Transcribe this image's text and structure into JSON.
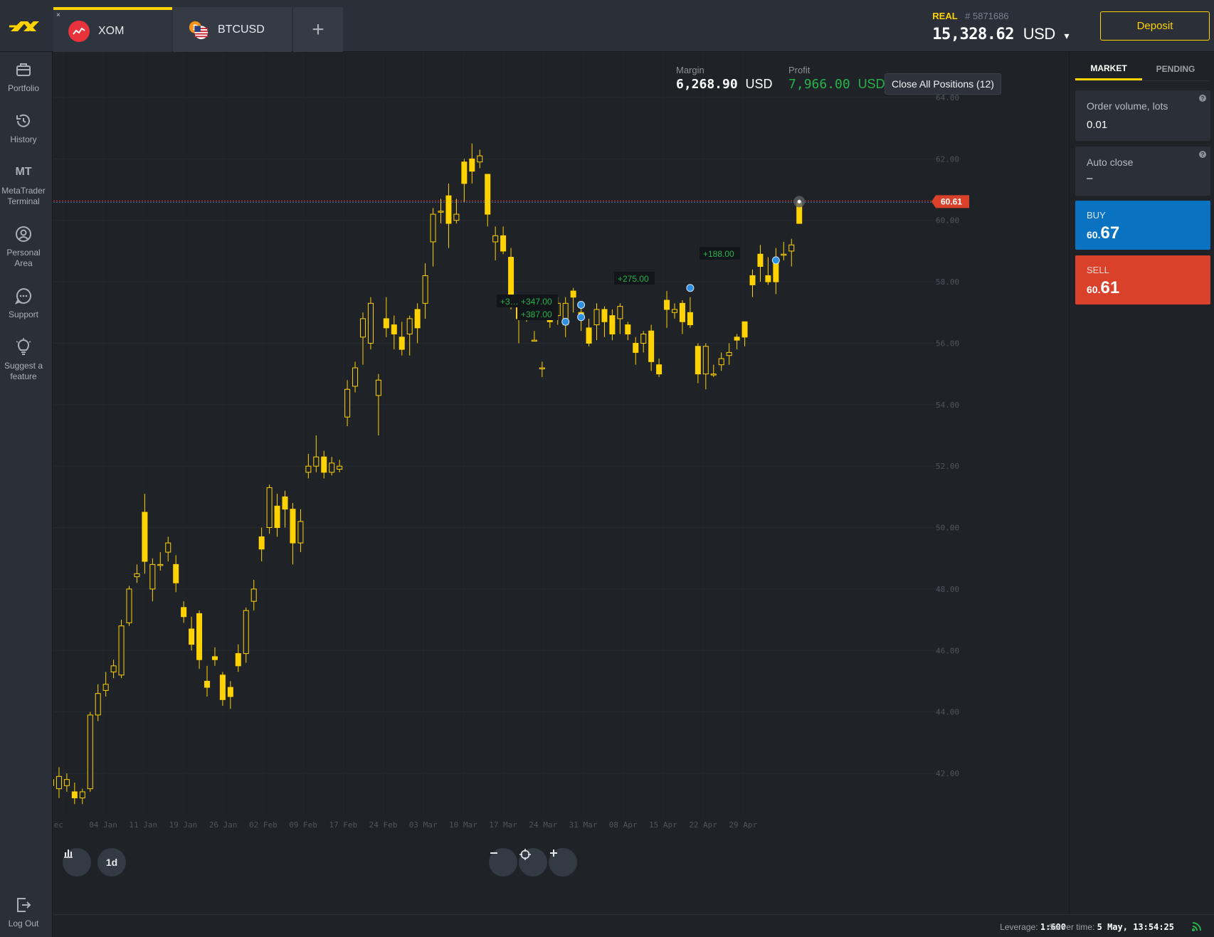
{
  "tabs": [
    {
      "label": "XOM",
      "active": true,
      "close": "×"
    },
    {
      "label": "BTCUSD",
      "active": false
    }
  ],
  "add_tab_label": "+",
  "account": {
    "type": "REAL",
    "number": "# 5871686",
    "balance": "15,328.62",
    "currency": "USD",
    "dropdown": "▾"
  },
  "deposit_label": "Deposit",
  "sidebar": {
    "items": [
      {
        "label": "Portfolio",
        "icon": "briefcase-icon"
      },
      {
        "label": "History",
        "icon": "history-icon"
      },
      {
        "label": "MetaTrader Terminal",
        "icon": "mt-icon",
        "icon_text": "MT"
      },
      {
        "label": "Personal Area",
        "icon": "user-icon"
      },
      {
        "label": "Support",
        "icon": "chat-icon"
      },
      {
        "label": "Suggest a feature",
        "icon": "lightbulb-icon"
      }
    ],
    "logout": "Log Out"
  },
  "metrics": {
    "margin_label": "Margin",
    "margin_value": "6,268.90",
    "margin_currency": "USD",
    "profit_label": "Profit",
    "profit_value": "7,966.00",
    "profit_currency": "USD"
  },
  "close_all_label": "Close All Positions (12)",
  "timeframe": "1d",
  "panel": {
    "tabs": [
      "MARKET",
      "PENDING"
    ],
    "order_volume_label": "Order volume, lots",
    "order_volume_value": "0.01",
    "auto_close_label": "Auto close",
    "auto_close_value": "–",
    "help": "?",
    "buy_label": "BUY",
    "buy_price_small": "60.",
    "buy_price_big": "67",
    "sell_label": "SELL",
    "sell_price_small": "60.",
    "sell_price_big": "61"
  },
  "status": {
    "leverage_label": "Leverage:",
    "leverage_value": "1:600",
    "server_time_label": "Server time:",
    "server_time_value": "5 May, 13:54:25"
  },
  "colors": {
    "accent": "#ffd200",
    "buy": "#0a73c1",
    "sell": "#d9412b",
    "profit": "#27b24a",
    "price_line": "#e0332c"
  },
  "chart_data": {
    "type": "candlestick",
    "symbol": "XOM",
    "timeframe": "1d",
    "y_ticks": [
      "42.00",
      "44.00",
      "46.00",
      "48.00",
      "50.00",
      "52.00",
      "54.00",
      "56.00",
      "58.00",
      "60.00",
      "62.00",
      "64.00"
    ],
    "x_ticks": [
      "Dec",
      "04 Jan",
      "11 Jan",
      "19 Jan",
      "26 Jan",
      "02 Feb",
      "09 Feb",
      "17 Feb",
      "24 Feb",
      "03 Mar",
      "10 Mar",
      "17 Mar",
      "24 Mar",
      "31 Mar",
      "08 Apr",
      "15 Apr",
      "22 Apr",
      "29 Apr"
    ],
    "ylim": [
      40.4,
      65.0
    ],
    "current_price": "60.61",
    "current_price_value": 60.61,
    "candles": [
      [
        41.6,
        41.8,
        41.3,
        41.9
      ],
      [
        41.5,
        41.9,
        41.2,
        42.2
      ],
      [
        41.6,
        41.8,
        41.4,
        42.0
      ],
      [
        41.4,
        41.2,
        41.0,
        41.7
      ],
      [
        41.2,
        41.4,
        41.0,
        41.5
      ],
      [
        41.5,
        43.9,
        41.4,
        44.0
      ],
      [
        43.9,
        44.6,
        43.7,
        44.9
      ],
      [
        44.7,
        44.9,
        44.5,
        45.3
      ],
      [
        45.3,
        45.5,
        45.1,
        45.7
      ],
      [
        45.2,
        46.8,
        45.1,
        47.0
      ],
      [
        46.9,
        48.0,
        46.8,
        48.1
      ],
      [
        48.4,
        48.5,
        48.2,
        48.8
      ],
      [
        50.5,
        48.9,
        48.5,
        51.1
      ],
      [
        48.0,
        48.8,
        47.6,
        49.0
      ],
      [
        48.8,
        48.8,
        48.6,
        49.2
      ],
      [
        49.2,
        49.5,
        48.9,
        49.7
      ],
      [
        48.8,
        48.2,
        47.9,
        49.1
      ],
      [
        47.4,
        47.1,
        46.9,
        47.6
      ],
      [
        46.7,
        46.2,
        46.0,
        47.1
      ],
      [
        47.2,
        45.7,
        45.4,
        47.3
      ],
      [
        45.0,
        44.8,
        44.5,
        45.5
      ],
      [
        45.8,
        45.7,
        45.5,
        46.1
      ],
      [
        45.2,
        44.4,
        44.2,
        45.3
      ],
      [
        44.8,
        44.5,
        44.1,
        45.0
      ],
      [
        45.9,
        45.5,
        45.3,
        46.2
      ],
      [
        45.9,
        47.3,
        45.6,
        47.4
      ],
      [
        47.6,
        48.0,
        47.3,
        48.3
      ],
      [
        49.7,
        49.3,
        48.9,
        50.0
      ],
      [
        50.0,
        51.3,
        49.8,
        51.4
      ],
      [
        50.7,
        50.0,
        49.7,
        51.1
      ],
      [
        51.0,
        50.6,
        50.0,
        51.2
      ],
      [
        50.6,
        49.5,
        48.8,
        50.8
      ],
      [
        49.5,
        50.2,
        49.2,
        50.6
      ],
      [
        51.8,
        52.0,
        51.6,
        52.4
      ],
      [
        52.0,
        52.3,
        51.8,
        53.0
      ],
      [
        52.3,
        51.8,
        51.6,
        52.5
      ],
      [
        51.8,
        52.1,
        51.7,
        52.3
      ],
      [
        51.9,
        52.0,
        51.8,
        52.2
      ],
      [
        53.6,
        54.5,
        53.3,
        54.8
      ],
      [
        54.6,
        55.2,
        54.4,
        55.4
      ],
      [
        56.2,
        56.8,
        55.3,
        57.0
      ],
      [
        56.0,
        57.3,
        55.8,
        57.5
      ],
      [
        54.3,
        54.8,
        53.0,
        55.0
      ],
      [
        56.8,
        56.5,
        56.2,
        57.5
      ],
      [
        56.6,
        56.3,
        55.8,
        56.9
      ],
      [
        56.2,
        55.8,
        55.6,
        56.7
      ],
      [
        56.3,
        56.8,
        55.6,
        56.9
      ],
      [
        57.1,
        56.5,
        56.0,
        57.3
      ],
      [
        57.3,
        58.2,
        56.8,
        58.6
      ],
      [
        59.3,
        60.2,
        58.5,
        60.4
      ],
      [
        60.3,
        60.3,
        59.9,
        60.7
      ],
      [
        60.8,
        59.9,
        59.1,
        61.2
      ],
      [
        60.0,
        60.2,
        59.9,
        60.7
      ],
      [
        61.9,
        61.2,
        60.6,
        62.0
      ],
      [
        62.0,
        61.6,
        61.2,
        62.5
      ],
      [
        61.9,
        62.1,
        61.7,
        62.3
      ],
      [
        61.5,
        60.2,
        59.8,
        61.5
      ],
      [
        59.3,
        59.5,
        58.7,
        59.8
      ],
      [
        59.5,
        59.0,
        58.9,
        59.8
      ],
      [
        58.8,
        57.3,
        57.1,
        59.1
      ],
      [
        57.2,
        56.8,
        56.0,
        57.5
      ],
      [
        57.1,
        57.3,
        56.7,
        57.4
      ],
      [
        56.1,
        56.1,
        56.1,
        56.4
      ],
      [
        55.2,
        55.2,
        54.9,
        55.4
      ],
      [
        56.8,
        56.7,
        56.5,
        57.3
      ],
      [
        56.9,
        57.3,
        56.6,
        57.5
      ],
      [
        56.6,
        57.3,
        56.2,
        57.5
      ],
      [
        57.7,
        57.5,
        57.0,
        57.8
      ],
      [
        57.0,
        56.8,
        56.4,
        57.3
      ],
      [
        56.5,
        56.0,
        55.9,
        56.8
      ],
      [
        56.6,
        57.1,
        56.1,
        57.3
      ],
      [
        57.1,
        56.7,
        56.2,
        57.2
      ],
      [
        56.9,
        56.3,
        56.1,
        57.1
      ],
      [
        56.8,
        57.2,
        56.3,
        57.3
      ],
      [
        56.6,
        56.3,
        56.1,
        56.7
      ],
      [
        56.0,
        55.7,
        55.3,
        56.2
      ],
      [
        56.0,
        56.3,
        55.7,
        56.4
      ],
      [
        56.4,
        55.4,
        55.1,
        56.6
      ],
      [
        55.3,
        55.0,
        54.9,
        55.5
      ],
      [
        57.4,
        57.1,
        56.5,
        57.7
      ],
      [
        57.0,
        57.1,
        56.8,
        57.3
      ],
      [
        57.3,
        56.7,
        56.3,
        57.4
      ],
      [
        57.0,
        56.6,
        56.5,
        57.5
      ],
      [
        55.9,
        55.0,
        54.7,
        56.0
      ],
      [
        55.0,
        55.9,
        54.5,
        56.0
      ],
      [
        55.0,
        55.0,
        54.9,
        55.3
      ],
      [
        55.3,
        55.5,
        55.1,
        55.7
      ],
      [
        55.6,
        55.7,
        55.3,
        56.0
      ],
      [
        56.2,
        56.1,
        55.8,
        56.3
      ],
      [
        56.7,
        56.2,
        55.9,
        56.7
      ],
      [
        58.2,
        57.9,
        57.5,
        58.4
      ],
      [
        58.9,
        58.5,
        58.0,
        59.2
      ],
      [
        58.2,
        58.0,
        57.9,
        58.8
      ],
      [
        58.7,
        58.0,
        57.6,
        59.1
      ],
      [
        58.9,
        58.9,
        58.7,
        59.3
      ],
      [
        59.0,
        59.2,
        58.5,
        59.4
      ],
      [
        60.6,
        59.9,
        59.9,
        60.7
      ]
    ],
    "position_labels": [
      "+188.00",
      "+275.00",
      "+347.00",
      "+387.00",
      "+3…"
    ]
  }
}
